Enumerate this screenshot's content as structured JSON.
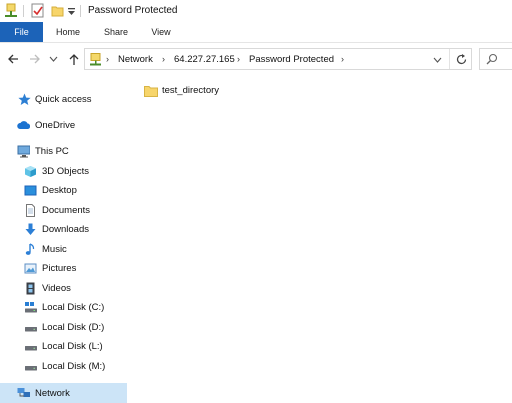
{
  "window": {
    "title": "Password Protected"
  },
  "ribbon": {
    "tabs": [
      "File",
      "Home",
      "Share",
      "View"
    ]
  },
  "address": {
    "crumbs": [
      "Network",
      "64.227.27.165",
      "Password Protected"
    ]
  },
  "nav": {
    "quick_access": "Quick access",
    "onedrive": "OneDrive",
    "this_pc": "This PC",
    "items": [
      "3D Objects",
      "Desktop",
      "Documents",
      "Downloads",
      "Music",
      "Pictures",
      "Videos",
      "Local Disk (C:)",
      "Local Disk (D:)",
      "Local Disk (L:)",
      "Local Disk (M:)"
    ],
    "network": "Network"
  },
  "content": {
    "items": [
      "test_directory"
    ]
  },
  "colors": {
    "accent": "#1c63b8",
    "selection": "#cce4f7",
    "folder": "#f7d56b"
  }
}
